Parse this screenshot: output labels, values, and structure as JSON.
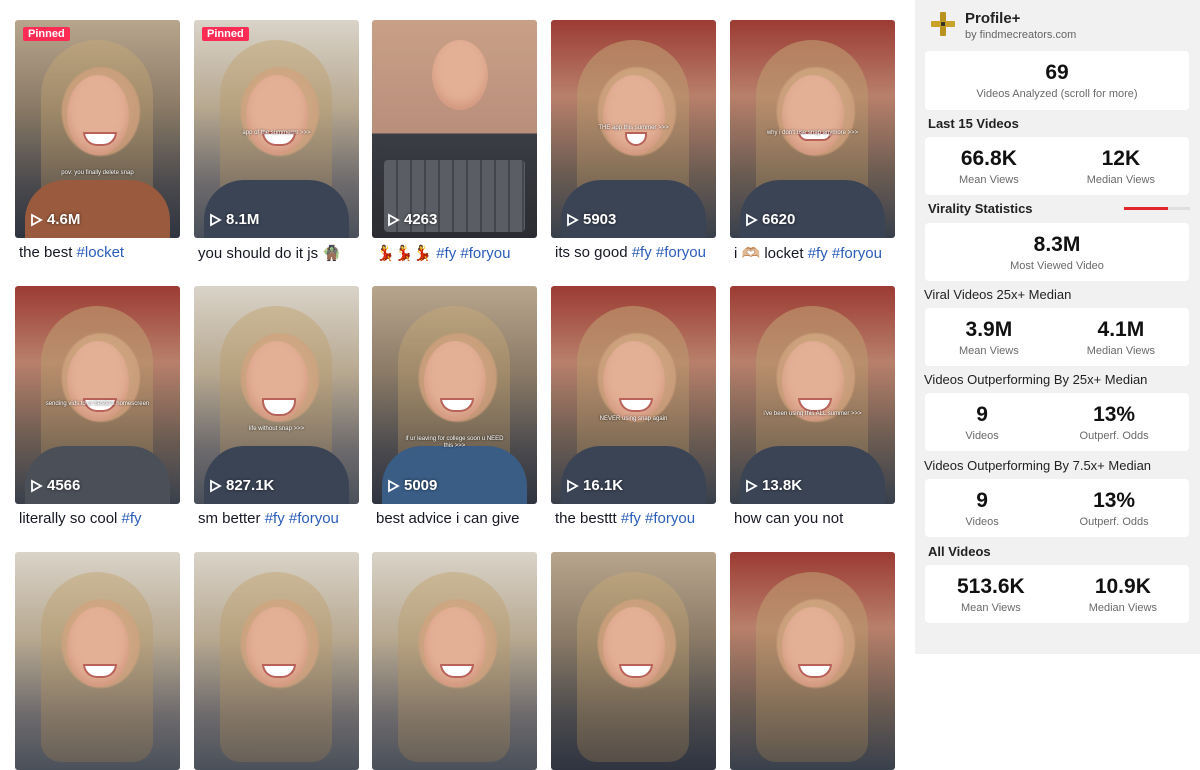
{
  "videos": [
    {
      "views": "4.6M",
      "pinned": "Pinned",
      "title": "the best ",
      "tags": "#locket",
      "caption": "pov: you finally delete snap"
    },
    {
      "views": "8.1M",
      "pinned": "Pinned",
      "title": "you should do it js 🧌",
      "tags": "",
      "caption": "app of the summerrrr >>>"
    },
    {
      "views": "4263",
      "pinned": "",
      "title": "💃💃💃 ",
      "tags": "#fy #foryou",
      "caption": ""
    },
    {
      "views": "5903",
      "pinned": "",
      "title": "its so good ",
      "tags": "#fy #foryou",
      "caption": "THE app this summer >>>"
    },
    {
      "views": "6620",
      "pinned": "",
      "title": "i 🫶🏼 locket ",
      "tags": "#fy #foryou",
      "caption": "why i don't use snap anymore >>>"
    },
    {
      "views": "4566",
      "pinned": "",
      "title": "literally so cool ",
      "tags": "#fy",
      "caption": "sending vids to ur bestie's homescreen"
    },
    {
      "views": "827.1K",
      "pinned": "",
      "title": "sm better ",
      "tags": "#fy #foryou",
      "caption": "life without snap >>>"
    },
    {
      "views": "5009",
      "pinned": "",
      "title": "best advice i can give",
      "tags": "",
      "caption": "if ur leaving for college soon u NEED this >>>"
    },
    {
      "views": "16.1K",
      "pinned": "",
      "title": "the besttt ",
      "tags": "#fy #foryou",
      "caption": "NEVER using snap again"
    },
    {
      "views": "13.8K",
      "pinned": "",
      "title": "how can you not",
      "tags": "",
      "caption": "i've been using this ALL summer >>>"
    }
  ],
  "panel": {
    "brand_name": "Profile+",
    "brand_sub": "by findmecreators.com",
    "analyzed_value": "69",
    "analyzed_label": "Videos Analyzed (scroll for more)",
    "last15_title": "Last 15 Videos",
    "last15": {
      "mean": "66.8K",
      "mean_label": "Mean Views",
      "median": "12K",
      "median_label": "Median Views"
    },
    "virality_title": "Virality Statistics",
    "virality_level": 0.67,
    "most_viewed": "8.3M",
    "most_viewed_label": "Most Viewed Video",
    "viral_title": "Viral Videos 25x+ Median",
    "viral": {
      "mean": "3.9M",
      "mean_label": "Mean Views",
      "median": "4.1M",
      "median_label": "Median Views"
    },
    "out25_title": "Videos Outperforming By 25x+ Median",
    "out25": {
      "count": "9",
      "count_label": "Videos",
      "odds": "13%",
      "odds_label": "Outperf. Odds"
    },
    "out75_title": "Videos Outperforming By 7.5x+ Median",
    "out75": {
      "count": "9",
      "count_label": "Videos",
      "odds": "13%",
      "odds_label": "Outperf. Odds"
    },
    "all_title": "All Videos",
    "all": {
      "mean": "513.6K",
      "mean_label": "Mean Views",
      "median": "10.9K",
      "median_label": "Median Views"
    }
  },
  "colors": {
    "accent": "#fe2c55",
    "hashtag": "#2b5db9",
    "bar": "#e0262b"
  }
}
